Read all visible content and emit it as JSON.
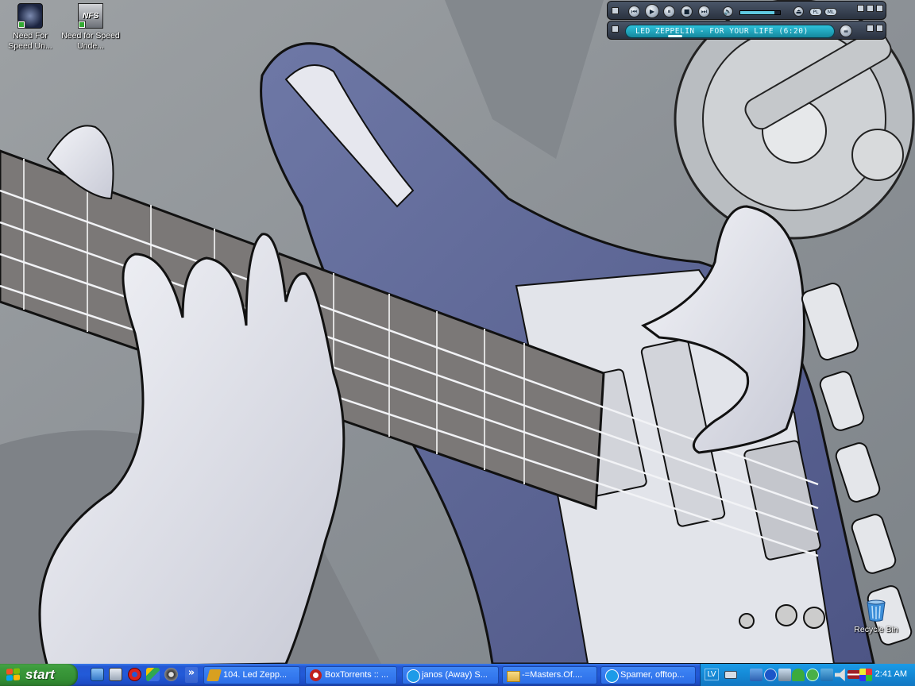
{
  "desktop": {
    "icons": [
      {
        "label": "Need For Speed Un...",
        "icon": "nfs-disc-icon"
      },
      {
        "label": "Need for Speed Unde...",
        "icon": "nfs-logo-icon",
        "logo_text": "NFS"
      },
      {
        "label": "Recycle Bin",
        "icon": "recycle-bin-icon"
      }
    ]
  },
  "winamp": {
    "now_playing": "LED ZEPPELIN - FOR YOUR LIFE (6:20)",
    "controls": [
      "previous",
      "play",
      "pause",
      "stop",
      "next"
    ],
    "pl_label": "PL",
    "ml_label": "ML",
    "volume_level": 0.85,
    "seek_position": 0.15
  },
  "taskbar": {
    "start_label": "start",
    "quick_launch": [
      "show-desktop-icon",
      "computer-icon",
      "opera-icon",
      "app-icon",
      "settings-icon"
    ],
    "overflow_label": "»",
    "tasks": [
      {
        "label": "104. Led Zepp...",
        "icon": "winamp-icon",
        "color": "#d8a020"
      },
      {
        "label": "BoxTorrents :: ...",
        "icon": "opera-icon",
        "color": "#c0201c"
      },
      {
        "label": "janos (Away) S...",
        "icon": "skype-icon",
        "color": "#1d9be8"
      },
      {
        "label": "-=Masters.Of....",
        "icon": "folder-icon",
        "color": "#e8c35a"
      },
      {
        "label": "Spamer, offtop...",
        "icon": "skype-icon",
        "color": "#1d9be8"
      }
    ],
    "tray": {
      "language": "LV",
      "clock": "2:41 AM"
    }
  }
}
